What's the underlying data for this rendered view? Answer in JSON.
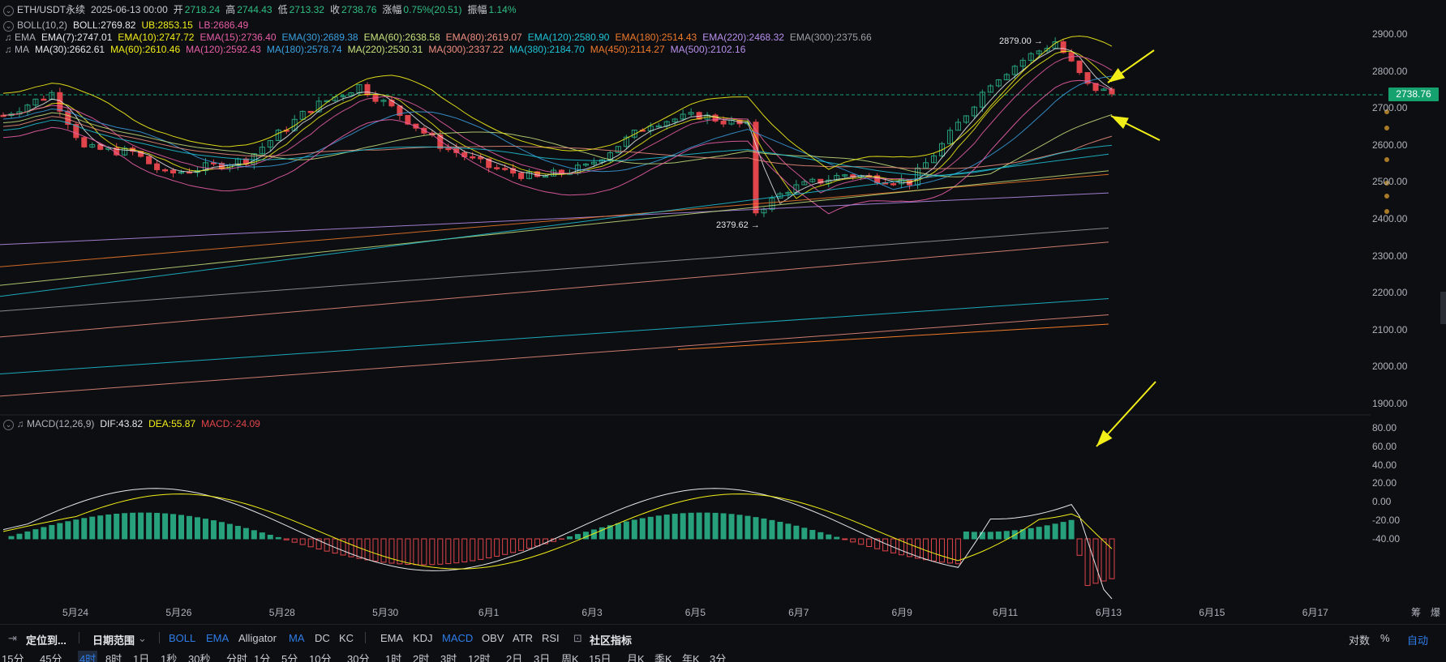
{
  "colors": {
    "bull": "#26a17b",
    "bear": "#e0454b",
    "arrow": "#f2ee18",
    "accent": "#2f7de8",
    "last_price_bg": "#15a26e"
  },
  "header": {
    "symbol": "ETH/USDT永续",
    "datetime": "2025-06-13 00:00",
    "open_label": "开",
    "open": "2718.24",
    "high_label": "高",
    "high": "2744.43",
    "low_label": "低",
    "low": "2713.32",
    "close_label": "收",
    "close": "2738.76",
    "change_label": "涨幅",
    "change": "0.75%(20.51)",
    "amplitude_label": "振幅",
    "amplitude": "1.14%"
  },
  "indicators": {
    "boll": {
      "name": "BOLL(10,2)",
      "mid": "BOLL:2769.82",
      "ub": "UB:2853.15",
      "lb": "LB:2686.49"
    },
    "ema": {
      "name": "EMA",
      "items": [
        {
          "text": "EMA(7):2747.01",
          "color": "#e6e7ea"
        },
        {
          "text": "EMA(10):2747.72",
          "color": "#f2ee18"
        },
        {
          "text": "EMA(15):2736.40",
          "color": "#e75ea6"
        },
        {
          "text": "EMA(30):2689.38",
          "color": "#3aa0e0"
        },
        {
          "text": "EMA(60):2638.58",
          "color": "#c7e27c"
        },
        {
          "text": "EMA(80):2619.07",
          "color": "#f08f80"
        },
        {
          "text": "EMA(120):2580.90",
          "color": "#1fc3d6"
        },
        {
          "text": "EMA(180):2514.43",
          "color": "#f07a2a"
        },
        {
          "text": "EMA(220):2468.32",
          "color": "#b990ee"
        },
        {
          "text": "EMA(300):2375.66",
          "color": "#9b9ea6"
        }
      ]
    },
    "ma": {
      "name": "MA",
      "items": [
        {
          "text": "MA(30):2662.61",
          "color": "#e6e7ea"
        },
        {
          "text": "MA(60):2610.46",
          "color": "#f2ee18"
        },
        {
          "text": "MA(120):2592.43",
          "color": "#e75ea6"
        },
        {
          "text": "MA(180):2578.74",
          "color": "#3aa0e0"
        },
        {
          "text": "MA(220):2530.31",
          "color": "#c7e27c"
        },
        {
          "text": "MA(300):2337.22",
          "color": "#f08f80"
        },
        {
          "text": "MA(380):2184.70",
          "color": "#1fc3d6"
        },
        {
          "text": "MA(450):2114.27",
          "color": "#f07a2a"
        },
        {
          "text": "MA(500):2102.16",
          "color": "#b990ee"
        }
      ]
    },
    "macd": {
      "name": "MACD(12,26,9)",
      "dif": "DIF:43.82",
      "dea": "DEA:55.87",
      "macd": "MACD:-24.09"
    }
  },
  "price_axis": [
    "2900.00",
    "2800.00",
    "2700.00",
    "2600.00",
    "2500.00",
    "2400.00",
    "2300.00",
    "2200.00",
    "2100.00",
    "2000.00",
    "1900.00"
  ],
  "last_price": "2738.76",
  "annotations": {
    "high": "2879.00",
    "low": "2379.62"
  },
  "macd_axis": [
    "80.00",
    "60.00",
    "40.00",
    "20.00",
    "0.00",
    "-20.00",
    "-40.00"
  ],
  "x_axis": {
    "labels": [
      "5月24",
      "5月26",
      "5月28",
      "5月30",
      "6月1",
      "6月3",
      "6月5",
      "6月7",
      "6月9",
      "6月11",
      "6月13",
      "6月15",
      "6月17"
    ],
    "settings_label": "筹",
    "settings_label2": "爆"
  },
  "toolbar": {
    "locate": "定位到...",
    "date_range": "日期范围",
    "main_indicators": [
      "BOLL",
      "EMA",
      "Alligator",
      "MA",
      "DC",
      "KC"
    ],
    "sub_indicators": [
      "EMA",
      "KDJ",
      "MACD",
      "OBV",
      "ATR",
      "RSI"
    ],
    "community": "社区指标",
    "right": [
      "对数",
      "%",
      "自动"
    ]
  },
  "timeframes": [
    "15分",
    "45分",
    "4时",
    "8时",
    "1日",
    "1秒",
    "30秒",
    "分时",
    "1分",
    "5分",
    "10分",
    "30分",
    "1时",
    "2时",
    "3时",
    "12时",
    "2日",
    "3日",
    "周K",
    "15日",
    "月K",
    "季K",
    "年K",
    "3分"
  ],
  "active_timeframe": "4时"
}
